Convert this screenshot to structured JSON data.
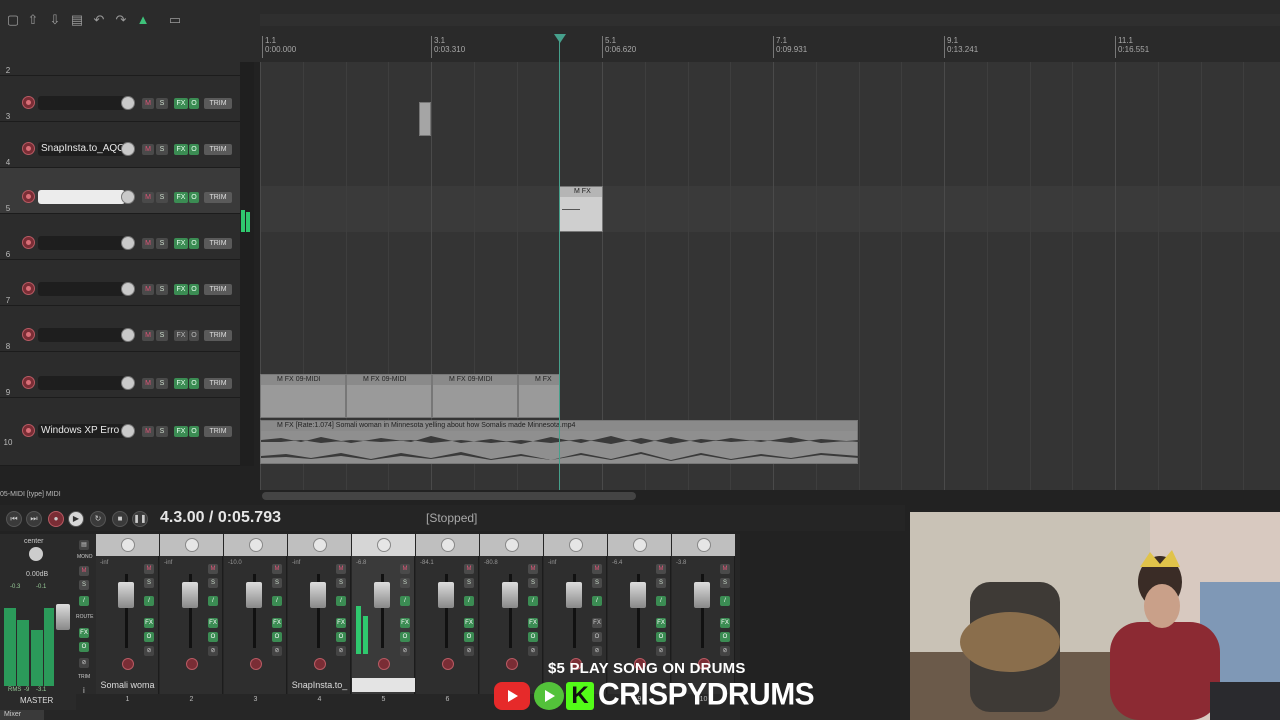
{
  "ruler": {
    "markers": [
      {
        "bar": "1.1",
        "time": "0:00.000"
      },
      {
        "bar": "3.1",
        "time": "0:03.310"
      },
      {
        "bar": "5.1",
        "time": "0:06.620"
      },
      {
        "bar": "7.1",
        "time": "0:09.931"
      },
      {
        "bar": "9.1",
        "time": "0:13.241"
      },
      {
        "bar": "11.1",
        "time": "0:16.551"
      }
    ]
  },
  "tracks": [
    {
      "num": "2",
      "name": ""
    },
    {
      "num": "3",
      "name": ""
    },
    {
      "num": "4",
      "name": "SnapInsta.to_AQO"
    },
    {
      "num": "5",
      "name": ""
    },
    {
      "num": "6",
      "name": ""
    },
    {
      "num": "7",
      "name": ""
    },
    {
      "num": "8",
      "name": ""
    },
    {
      "num": "9",
      "name": ""
    },
    {
      "num": "10",
      "name": "Windows XP Erro"
    }
  ],
  "track_buttons": {
    "mute": "M",
    "solo": "S",
    "fx": "FX",
    "io": "O",
    "trim": "TRIM"
  },
  "items": {
    "midi_label_1": "09-MIDI",
    "midi_label_2": "09-MIDI",
    "midi_label_3": "09-MIDI",
    "audio_label": "[Rate:1.074] Somali woman in Minnesota yelling about how Somalis made Minnesota.mp4"
  },
  "status": {
    "selected": "05-MIDI [type] MIDI"
  },
  "transport": {
    "position": "4.3.00 / 0:05.793",
    "state": "[Stopped]"
  },
  "master": {
    "pan": "center",
    "vol": "0.00dB",
    "peak_l": "-0.3",
    "peak_r": "-0.1",
    "rms_label": "RMS",
    "rms_l": "-9",
    "rms_r": "-3.1",
    "name": "MASTER",
    "side_labels": [
      "MONO",
      "ROUTE",
      "TRIM"
    ]
  },
  "mixer_channels": [
    {
      "num": "1",
      "name": "Somali woma",
      "val": "-inf"
    },
    {
      "num": "2",
      "name": "",
      "val": "-inf"
    },
    {
      "num": "3",
      "name": "",
      "val": "-10.0"
    },
    {
      "num": "4",
      "name": "SnapInsta.to_",
      "val": "-inf"
    },
    {
      "num": "5",
      "name": "",
      "val": "-6.8"
    },
    {
      "num": "6",
      "name": "",
      "val": "-84.1"
    },
    {
      "num": "7",
      "name": "",
      "val": "-80.8"
    },
    {
      "num": "8",
      "name": "",
      "val": "-inf"
    },
    {
      "num": "9",
      "name": "",
      "val": "-6.4"
    },
    {
      "num": "10",
      "name": "",
      "val": "-3.8"
    }
  ],
  "mixer_tab": "Mixer",
  "overlay": {
    "promo": "$5 PLAY SONG ON DRUMS",
    "brand": "CRISPYDRUMS"
  },
  "colors": {
    "accent_green": "#3ec27a",
    "playhead": "#46a08c",
    "record_red": "#b85a63"
  }
}
